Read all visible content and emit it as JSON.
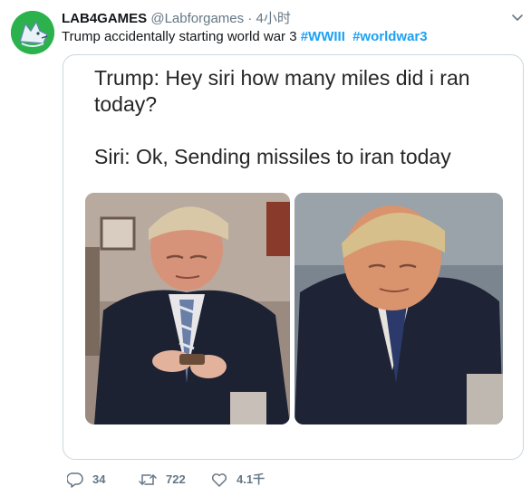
{
  "account": {
    "display_name": "LAB4GAMES",
    "handle": "@Labforgames",
    "separator": "·",
    "time": "4小时"
  },
  "tweet": {
    "text": "Trump accidentally starting world war 3 ",
    "hashtags": [
      "#WWIII",
      "#worldwar3"
    ]
  },
  "meme": {
    "line1": "Trump: Hey siri how many miles did i ran",
    "line2": "today?",
    "line3": "Siri: Ok, Sending missiles to iran today"
  },
  "actions": {
    "replies": "34",
    "retweets": "722",
    "likes": "4.1千"
  },
  "colors": {
    "link": "#1da1f2",
    "muted": "#657786",
    "avatar_bg": "#2bb24c",
    "border": "#ccd6dd"
  },
  "icons": {
    "avatar": "wolf-logo",
    "caret": "chevron-down-icon",
    "reply": "reply-icon",
    "retweet": "retweet-icon",
    "like": "heart-icon"
  }
}
